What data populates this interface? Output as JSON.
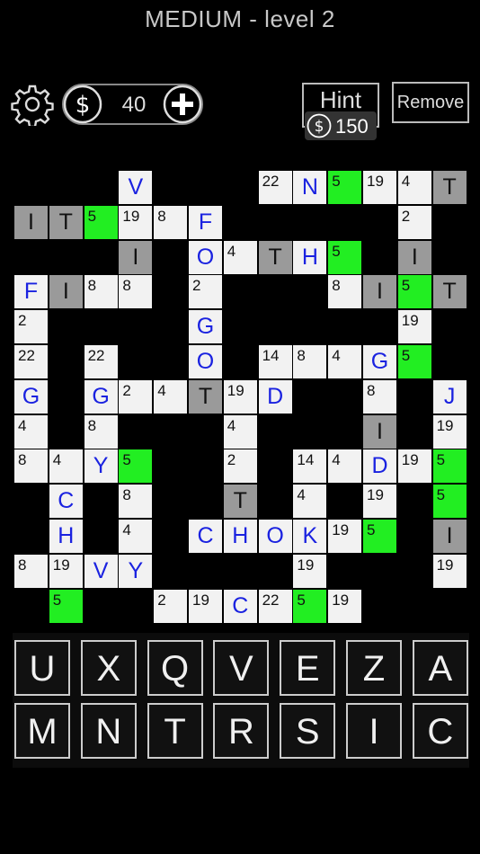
{
  "header": {
    "title": "MEDIUM - level 2"
  },
  "toolbar": {
    "coins": "40",
    "hint_label": "Hint",
    "hint_cost": "150",
    "remove_label": "Remove"
  },
  "cells": [
    {
      "c": 3,
      "r": 0,
      "t": "w",
      "l": "V"
    },
    {
      "c": 7,
      "r": 0,
      "t": "w",
      "n": "22"
    },
    {
      "c": 8,
      "r": 0,
      "t": "w",
      "l": "N"
    },
    {
      "c": 9,
      "r": 0,
      "t": "g",
      "n": "5"
    },
    {
      "c": 10,
      "r": 0,
      "t": "w",
      "n": "19"
    },
    {
      "c": 11,
      "r": 0,
      "t": "w",
      "n": "4"
    },
    {
      "c": 12,
      "r": 0,
      "t": "d",
      "l": "T"
    },
    {
      "c": 0,
      "r": 1,
      "t": "d",
      "l": "I"
    },
    {
      "c": 1,
      "r": 1,
      "t": "d",
      "l": "T"
    },
    {
      "c": 2,
      "r": 1,
      "t": "g",
      "n": "5"
    },
    {
      "c": 3,
      "r": 1,
      "t": "w",
      "n": "19"
    },
    {
      "c": 4,
      "r": 1,
      "t": "w",
      "n": "8"
    },
    {
      "c": 5,
      "r": 1,
      "t": "w",
      "l": "F"
    },
    {
      "c": 11,
      "r": 1,
      "t": "w",
      "n": "2"
    },
    {
      "c": 3,
      "r": 2,
      "t": "d",
      "l": "I"
    },
    {
      "c": 5,
      "r": 2,
      "t": "w",
      "l": "O"
    },
    {
      "c": 6,
      "r": 2,
      "t": "w",
      "n": "4"
    },
    {
      "c": 7,
      "r": 2,
      "t": "d",
      "l": "T"
    },
    {
      "c": 8,
      "r": 2,
      "t": "w",
      "l": "H"
    },
    {
      "c": 9,
      "r": 2,
      "t": "g",
      "n": "5"
    },
    {
      "c": 11,
      "r": 2,
      "t": "d",
      "l": "I"
    },
    {
      "c": 0,
      "r": 3,
      "t": "w",
      "l": "F"
    },
    {
      "c": 1,
      "r": 3,
      "t": "d",
      "l": "I"
    },
    {
      "c": 2,
      "r": 3,
      "t": "w",
      "n": "8"
    },
    {
      "c": 3,
      "r": 3,
      "t": "w",
      "n": "8"
    },
    {
      "c": 5,
      "r": 3,
      "t": "w",
      "n": "2"
    },
    {
      "c": 9,
      "r": 3,
      "t": "w",
      "n": "8"
    },
    {
      "c": 10,
      "r": 3,
      "t": "d",
      "l": "I"
    },
    {
      "c": 11,
      "r": 3,
      "t": "g",
      "n": "5"
    },
    {
      "c": 12,
      "r": 3,
      "t": "d",
      "l": "T"
    },
    {
      "c": 0,
      "r": 4,
      "t": "w",
      "n": "2"
    },
    {
      "c": 5,
      "r": 4,
      "t": "w",
      "l": "G"
    },
    {
      "c": 11,
      "r": 4,
      "t": "w",
      "n": "19"
    },
    {
      "c": 0,
      "r": 5,
      "t": "w",
      "n": "22"
    },
    {
      "c": 2,
      "r": 5,
      "t": "w",
      "n": "22"
    },
    {
      "c": 5,
      "r": 5,
      "t": "w",
      "l": "O"
    },
    {
      "c": 7,
      "r": 5,
      "t": "w",
      "n": "14"
    },
    {
      "c": 8,
      "r": 5,
      "t": "w",
      "n": "8"
    },
    {
      "c": 9,
      "r": 5,
      "t": "w",
      "n": "4"
    },
    {
      "c": 10,
      "r": 5,
      "t": "w",
      "l": "G"
    },
    {
      "c": 11,
      "r": 5,
      "t": "g",
      "n": "5"
    },
    {
      "c": 0,
      "r": 6,
      "t": "w",
      "l": "G"
    },
    {
      "c": 2,
      "r": 6,
      "t": "w",
      "l": "G"
    },
    {
      "c": 3,
      "r": 6,
      "t": "w",
      "n": "2"
    },
    {
      "c": 4,
      "r": 6,
      "t": "w",
      "n": "4"
    },
    {
      "c": 5,
      "r": 6,
      "t": "d",
      "l": "T"
    },
    {
      "c": 6,
      "r": 6,
      "t": "w",
      "n": "19"
    },
    {
      "c": 7,
      "r": 6,
      "t": "w",
      "l": "D"
    },
    {
      "c": 10,
      "r": 6,
      "t": "w",
      "n": "8"
    },
    {
      "c": 12,
      "r": 6,
      "t": "w",
      "l": "J"
    },
    {
      "c": 0,
      "r": 7,
      "t": "w",
      "n": "4"
    },
    {
      "c": 2,
      "r": 7,
      "t": "w",
      "n": "8"
    },
    {
      "c": 6,
      "r": 7,
      "t": "w",
      "n": "4"
    },
    {
      "c": 10,
      "r": 7,
      "t": "d",
      "l": "I"
    },
    {
      "c": 12,
      "r": 7,
      "t": "w",
      "n": "19"
    },
    {
      "c": 0,
      "r": 8,
      "t": "w",
      "n": "8"
    },
    {
      "c": 1,
      "r": 8,
      "t": "w",
      "n": "4"
    },
    {
      "c": 2,
      "r": 8,
      "t": "w",
      "l": "Y"
    },
    {
      "c": 3,
      "r": 8,
      "t": "g",
      "n": "5"
    },
    {
      "c": 6,
      "r": 8,
      "t": "w",
      "n": "2"
    },
    {
      "c": 8,
      "r": 8,
      "t": "w",
      "n": "14"
    },
    {
      "c": 9,
      "r": 8,
      "t": "w",
      "n": "4"
    },
    {
      "c": 10,
      "r": 8,
      "t": "w",
      "l": "D"
    },
    {
      "c": 11,
      "r": 8,
      "t": "w",
      "n": "19"
    },
    {
      "c": 12,
      "r": 8,
      "t": "g",
      "n": "5"
    },
    {
      "c": 1,
      "r": 9,
      "t": "w",
      "l": "C"
    },
    {
      "c": 3,
      "r": 9,
      "t": "w",
      "n": "8"
    },
    {
      "c": 6,
      "r": 9,
      "t": "d",
      "l": "T"
    },
    {
      "c": 8,
      "r": 9,
      "t": "w",
      "n": "4"
    },
    {
      "c": 10,
      "r": 9,
      "t": "w",
      "n": "19"
    },
    {
      "c": 12,
      "r": 9,
      "t": "g",
      "n": "5"
    },
    {
      "c": 1,
      "r": 10,
      "t": "w",
      "l": "H"
    },
    {
      "c": 3,
      "r": 10,
      "t": "w",
      "n": "4"
    },
    {
      "c": 5,
      "r": 10,
      "t": "w",
      "l": "C"
    },
    {
      "c": 6,
      "r": 10,
      "t": "w",
      "l": "H"
    },
    {
      "c": 7,
      "r": 10,
      "t": "w",
      "l": "O"
    },
    {
      "c": 8,
      "r": 10,
      "t": "w",
      "l": "K"
    },
    {
      "c": 9,
      "r": 10,
      "t": "w",
      "n": "19"
    },
    {
      "c": 10,
      "r": 10,
      "t": "g",
      "n": "5"
    },
    {
      "c": 12,
      "r": 10,
      "t": "d",
      "l": "I"
    },
    {
      "c": 0,
      "r": 11,
      "t": "w",
      "n": "8"
    },
    {
      "c": 1,
      "r": 11,
      "t": "w",
      "n": "19"
    },
    {
      "c": 2,
      "r": 11,
      "t": "w",
      "l": "V"
    },
    {
      "c": 3,
      "r": 11,
      "t": "w",
      "l": "Y"
    },
    {
      "c": 8,
      "r": 11,
      "t": "w",
      "n": "19"
    },
    {
      "c": 12,
      "r": 11,
      "t": "w",
      "n": "19"
    },
    {
      "c": 1,
      "r": 12,
      "t": "g",
      "n": "5"
    },
    {
      "c": 4,
      "r": 12,
      "t": "w",
      "n": "2"
    },
    {
      "c": 5,
      "r": 12,
      "t": "w",
      "n": "19"
    },
    {
      "c": 6,
      "r": 12,
      "t": "w",
      "l": "C"
    },
    {
      "c": 7,
      "r": 12,
      "t": "w",
      "n": "22"
    },
    {
      "c": 8,
      "r": 12,
      "t": "g",
      "n": "5"
    },
    {
      "c": 9,
      "r": 12,
      "t": "w",
      "n": "19"
    }
  ],
  "keyboard": {
    "row1": [
      "U",
      "X",
      "Q",
      "V",
      "E",
      "Z",
      "A"
    ],
    "row2": [
      "M",
      "N",
      "T",
      "R",
      "S",
      "I",
      "C"
    ]
  }
}
